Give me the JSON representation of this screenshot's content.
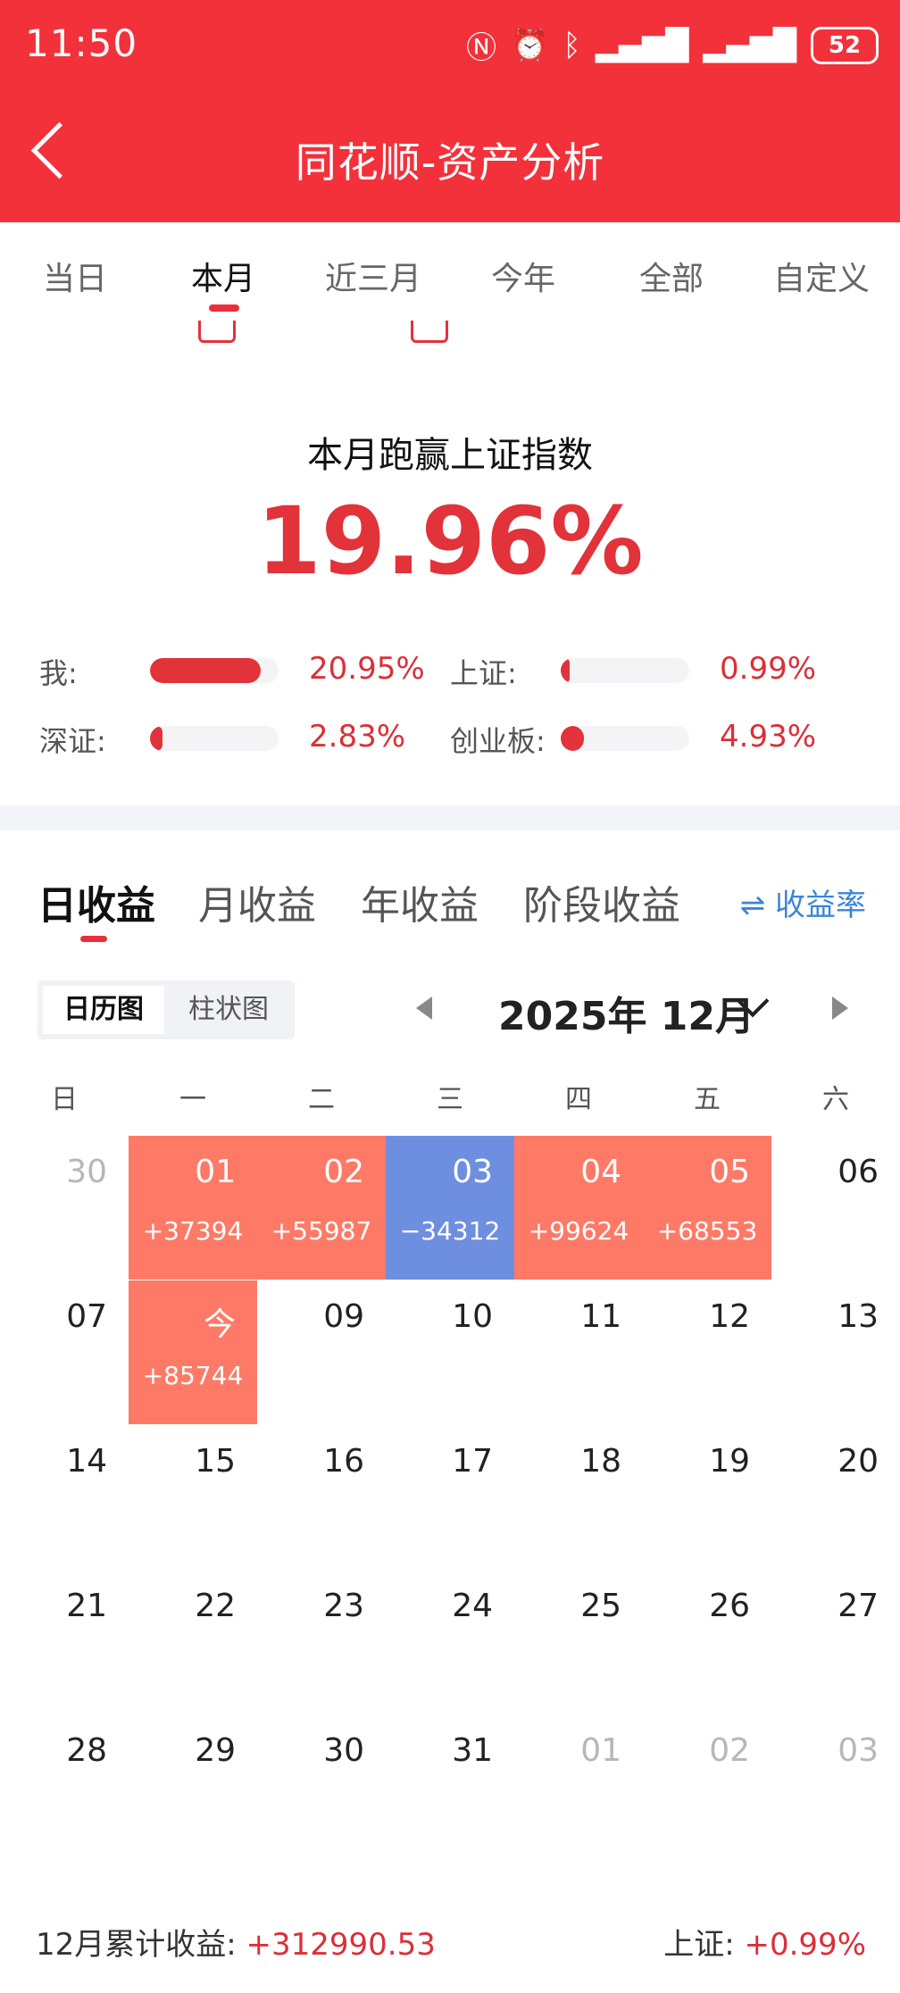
{
  "status_bar": {
    "time": "11:50",
    "battery": "52"
  },
  "header": {
    "title": "同花顺-资产分析"
  },
  "tabs": [
    {
      "label": "当日"
    },
    {
      "label": "本月"
    },
    {
      "label": "近三月"
    },
    {
      "label": "今年"
    },
    {
      "label": "全部"
    },
    {
      "label": "自定义"
    }
  ],
  "summary": {
    "headline": "本月跑赢上证指数",
    "outperform_pct": "19.96%",
    "comparisons": [
      {
        "label": "我:",
        "value": "20.95%",
        "fill": 0.86
      },
      {
        "label": "上证:",
        "value": "0.99%",
        "fill": 0.04
      },
      {
        "label": "深证:",
        "value": "2.83%",
        "fill": 0.1
      },
      {
        "label": "创业板:",
        "value": "4.93%",
        "fill": 0.18
      }
    ]
  },
  "calendar": {
    "tabs": [
      {
        "label": "日收益"
      },
      {
        "label": "月收益"
      },
      {
        "label": "年收益"
      },
      {
        "label": "阶段收益"
      }
    ],
    "rate_toggle": "⇌ 收益率",
    "view_toggle": [
      {
        "label": "日历图"
      },
      {
        "label": "柱状图"
      }
    ],
    "month_label": "2025年 12月",
    "weekdays": [
      "日",
      "一",
      "二",
      "三",
      "四",
      "五",
      "六"
    ],
    "weeks": [
      [
        {
          "n": "30",
          "m": true
        },
        {
          "n": "01",
          "a": "+37394",
          "t": "gain"
        },
        {
          "n": "02",
          "a": "+55987",
          "t": "gain"
        },
        {
          "n": "03",
          "a": "−34312",
          "t": "loss"
        },
        {
          "n": "04",
          "a": "+99624",
          "t": "gain"
        },
        {
          "n": "05",
          "a": "+68553",
          "t": "gain"
        },
        {
          "n": "06"
        }
      ],
      [
        {
          "n": "07"
        },
        {
          "n": "今",
          "a": "+85744",
          "t": "gain"
        },
        {
          "n": "09"
        },
        {
          "n": "10"
        },
        {
          "n": "11"
        },
        {
          "n": "12"
        },
        {
          "n": "13"
        }
      ],
      [
        {
          "n": "14"
        },
        {
          "n": "15"
        },
        {
          "n": "16"
        },
        {
          "n": "17"
        },
        {
          "n": "18"
        },
        {
          "n": "19"
        },
        {
          "n": "20"
        }
      ],
      [
        {
          "n": "21"
        },
        {
          "n": "22"
        },
        {
          "n": "23"
        },
        {
          "n": "24"
        },
        {
          "n": "25"
        },
        {
          "n": "26"
        },
        {
          "n": "27"
        }
      ],
      [
        {
          "n": "28"
        },
        {
          "n": "29"
        },
        {
          "n": "30"
        },
        {
          "n": "31"
        },
        {
          "n": "01",
          "m": true
        },
        {
          "n": "02",
          "m": true
        },
        {
          "n": "03",
          "m": true
        }
      ]
    ],
    "footer": {
      "cum_label": "12月累计收益:",
      "cum_value": "+312990.53",
      "index_label": "上证:",
      "index_value": "+0.99%"
    }
  },
  "colors": {
    "brand_red": "#f2313b",
    "gain": "#fe7a66",
    "loss": "#6e8ee0",
    "link_blue": "#3b86d6"
  }
}
